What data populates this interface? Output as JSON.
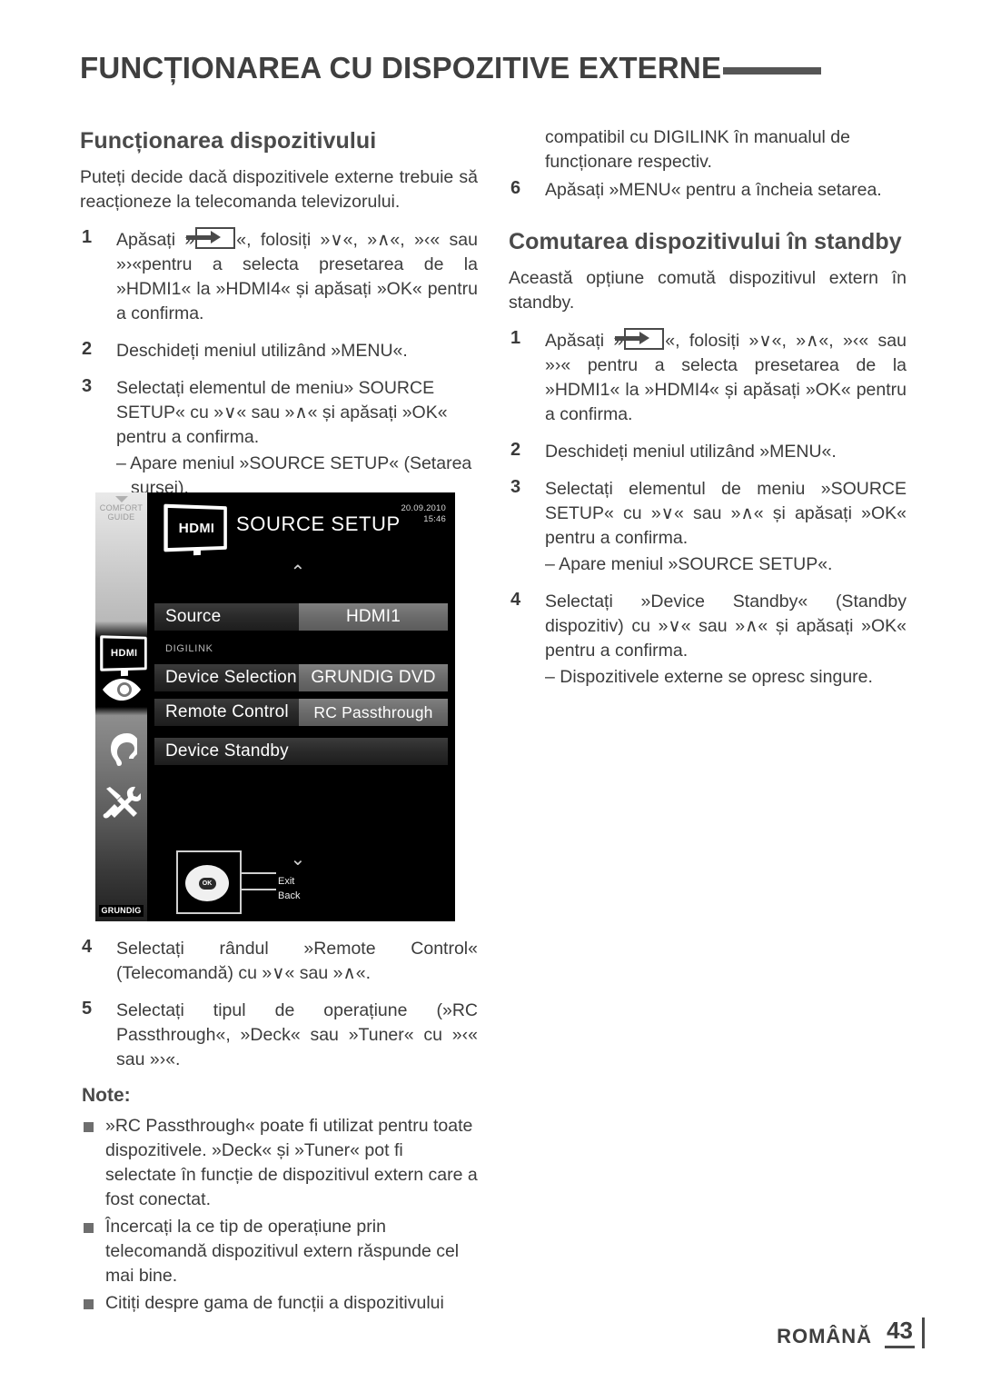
{
  "header": {
    "title": "FUNCȚIONAREA CU DISPOZITIVE EXTERNE"
  },
  "left_column": {
    "section_title": "Funcționarea dispozitivului",
    "intro": "Puteți decide dacă dispozitivele externe trebuie să reacționeze la telecomanda televizorului.",
    "steps": [
      {
        "num": "1",
        "text_before_icon": "Apăsați »",
        "icon": "source-arrow-icon",
        "text_after_icon": "«, folosiți »∨«, »∧«, »‹« sau »›«pentru a selecta presetarea de la »HDMI1« la »HDMI4« și apăsați »OK« pentru a confirma."
      },
      {
        "num": "2",
        "text": "Deschideți meniul utilizând »MENU«."
      },
      {
        "num": "3",
        "text": "Selectați elementul de meniu» SOURCE SETUP« cu »∨« sau »∧« și apăsați »OK« pentru a confirma.",
        "sub": "– Apare meniul »SOURCE SETUP« (Setarea sursei)."
      },
      {
        "num": "4",
        "text": "Selectați rândul »Remote Control« (Telecomandă) cu »∨« sau »∧«."
      },
      {
        "num": "5",
        "text": "Selectați tipul de operațiune (»RC Passthrough«, »Deck« sau »Tuner« cu »‹« sau »›«."
      }
    ],
    "note_heading": "Note:",
    "notes": [
      "»RC Passthrough« poate fi utilizat pentru toate dispozitivele. »Deck« și »Tuner« pot fi selectate în funcție de dispozitivul extern care a fost conectat.",
      "Încercați la ce tip de operațiune prin telecomandă dispozitivul extern răspunde cel mai bine.",
      "Citiți despre gama de funcții a dispozitivului"
    ]
  },
  "right_column": {
    "continued_text": "compatibil cu DIGILINK în manualul de funcționare respectiv.",
    "step6": {
      "num": "6",
      "text": "Apăsați »MENU« pentru a încheia setarea."
    },
    "section_title": "Comutarea dispozitivului în standby",
    "intro": "Această opțiune comută dispozitivul extern în standby.",
    "steps": [
      {
        "num": "1",
        "text_before_icon": "Apăsați »",
        "icon": "source-arrow-icon",
        "text_after_icon": "«, folosiți »∨«, »∧«, »‹« sau »›« pentru a selecta presetarea de la »HDMI1« la »HDMI4« și apăsați »OK« pentru a confirma."
      },
      {
        "num": "2",
        "text": "Deschideți meniul utilizând »MENU«."
      },
      {
        "num": "3",
        "text": "Selectați elementul de meniu »SOURCE SETUP« cu »∨« sau »∧« și apăsați »OK« pentru a confirma.",
        "sub": "– Apare meniul »SOURCE SETUP«."
      },
      {
        "num": "4",
        "text": "Selectați »Device Standby« (Standby dispozitiv) cu »∨« sau »∧« și apăsați »OK« pentru a confirma.",
        "sub": "– Dispozitivele externe se opresc singure."
      }
    ]
  },
  "tv_screenshot": {
    "comfort_guide_label_line1": "COMFORT",
    "comfort_guide_label_line2": "GUIDE",
    "logo_caption": "HDMI",
    "title": "SOURCE SETUP",
    "date": "20.09.2010",
    "time": "15:46",
    "sidebar_hdmi_caption": "HDMI",
    "group_label": "DIGILINK",
    "rows": [
      {
        "label": "Source",
        "value": "HDMI1"
      },
      {
        "label": "Device Selection",
        "value": "GRUNDIG DVD"
      },
      {
        "label": "Remote Control",
        "value": "RC Passthrough"
      },
      {
        "label": "Device Standby",
        "value": ""
      }
    ],
    "brand": "GRUNDIG",
    "hint_exit": "Exit",
    "hint_back": "Back",
    "ok_button": "OK",
    "chevron_up": "⌃",
    "chevron_down": "⌄"
  },
  "footer": {
    "language": "ROMÂNĂ",
    "page": "43"
  },
  "colors": {
    "text": "#3c3c3c",
    "heading": "#4a4a4a",
    "tv_bg": "#000000",
    "tv_value_bg": "#6b6b6b"
  }
}
